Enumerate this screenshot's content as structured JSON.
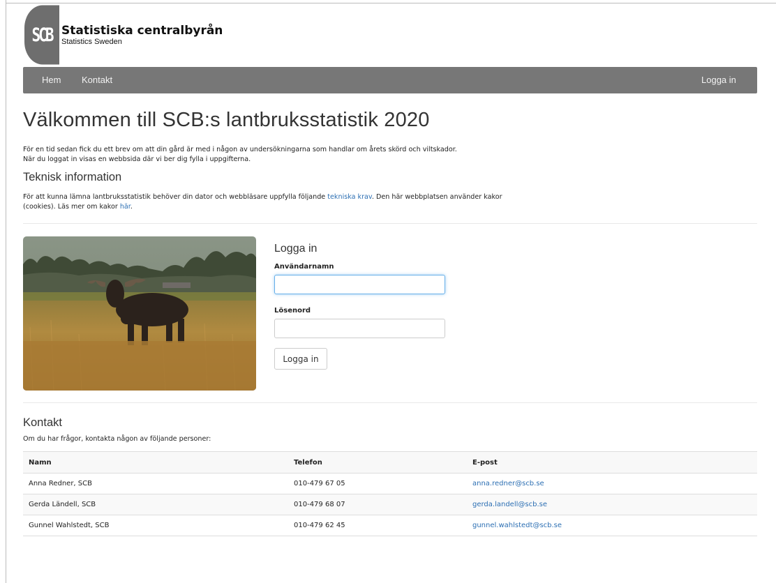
{
  "brand": {
    "logo_mark": "SCB",
    "title": "Statistiska centralbyrån",
    "subtitle": "Statistics Sweden"
  },
  "nav": {
    "items": [
      {
        "label": "Hem"
      },
      {
        "label": "Kontakt"
      }
    ],
    "login": "Logga in"
  },
  "main": {
    "heading": "Välkommen till SCB:s lantbruksstatistik 2020",
    "intro_line1": "För en tid sedan fick du ett brev om att din gård är med i någon av undersökningarna som handlar om årets skörd och viltskador.",
    "intro_line2": "När du loggat in visas en webbsida där vi ber dig fylla i uppgifterna.",
    "tech_heading": "Teknisk information",
    "tech_text_before": "För att kunna lämna lantbruksstatistik behöver din dator och webbläsare uppfylla följande ",
    "tech_link": "tekniska krav",
    "tech_text_mid": ". Den här webbplatsen använder kakor (cookies). Läs mer om kakor ",
    "cookie_link": "här",
    "tech_text_end": "."
  },
  "login": {
    "title": "Logga in",
    "username_label": "Användarnamn",
    "username_value": "",
    "password_label": "Lösenord",
    "password_value": "",
    "submit": "Logga in"
  },
  "contact": {
    "heading": "Kontakt",
    "intro": "Om du har frågor, kontakta någon av följande personer:",
    "columns": [
      "Namn",
      "Telefon",
      "E-post"
    ],
    "rows": [
      {
        "name": "Anna Redner, SCB",
        "phone": "010-479 67 05",
        "email": "anna.redner@scb.se"
      },
      {
        "name": "Gerda Ländell, SCB",
        "phone": "010-479 68 07",
        "email": "gerda.landell@scb.se"
      },
      {
        "name": "Gunnel Wahlstedt, SCB",
        "phone": "010-479 62 45",
        "email": "gunnel.wahlstedt@scb.se"
      }
    ]
  },
  "colors": {
    "navbar": "#777777",
    "link": "#2c6fb3"
  }
}
